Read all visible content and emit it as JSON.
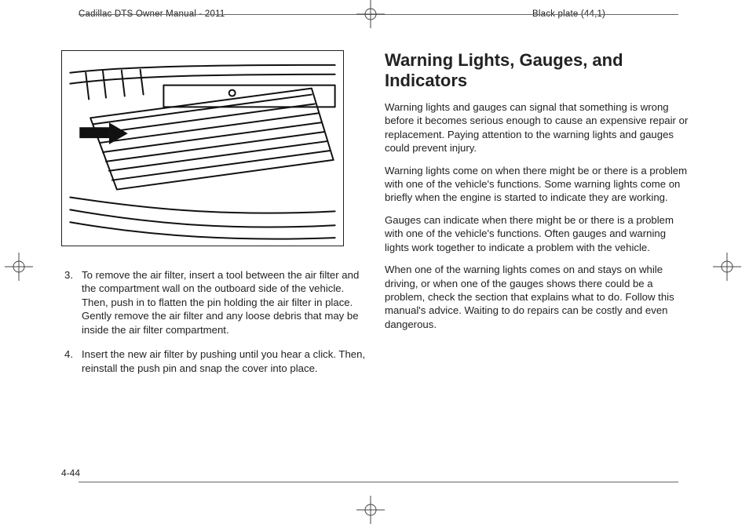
{
  "header": {
    "manual_title": "Cadillac DTS Owner Manual - 2011",
    "plate": "Black plate (44,1)"
  },
  "left": {
    "figure_alt": "Line drawing of air filter compartment under dashboard with arrow indicating tool insertion point.",
    "steps": [
      "To remove the air filter, insert a tool between the air filter and the compartment wall on the outboard side of the vehicle. Then, push in to flatten the pin holding the air filter in place. Gently remove the air filter and any loose debris that may be inside the air filter compartment.",
      "Insert the new air filter by pushing until you hear a click. Then, reinstall the push pin and snap the cover into place."
    ]
  },
  "right": {
    "heading": "Warning Lights, Gauges, and Indicators",
    "paragraphs": [
      "Warning lights and gauges can signal that something is wrong before it becomes serious enough to cause an expensive repair or replacement. Paying attention to the warning lights and gauges could prevent injury.",
      "Warning lights come on when there might be or there is a problem with one of the vehicle's functions. Some warning lights come on briefly when the engine is started to indicate they are working.",
      "Gauges can indicate when there might be or there is a problem with one of the vehicle's functions. Often gauges and warning lights work together to indicate a problem with the vehicle.",
      "When one of the warning lights comes on and stays on while driving, or when one of the gauges shows there could be a problem, check the section that explains what to do. Follow this manual's advice. Waiting to do repairs can be costly and even dangerous."
    ]
  },
  "page_number": "4-44"
}
